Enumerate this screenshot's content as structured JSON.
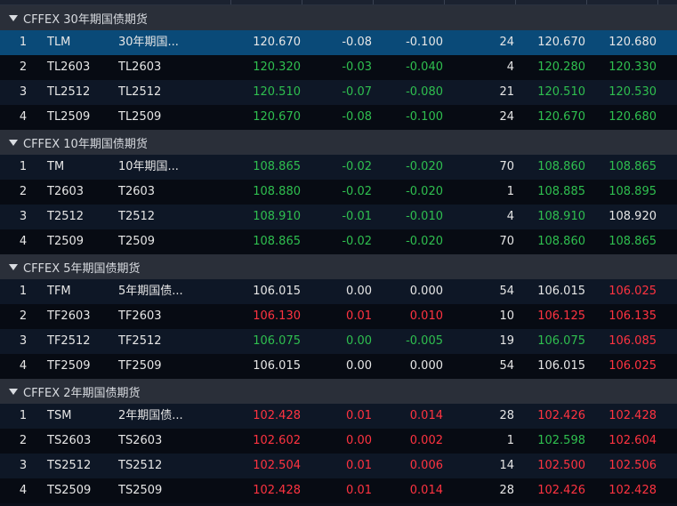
{
  "colors": {
    "up": "#ff3340",
    "down": "#2fbf4f",
    "flat": "#e6e6e6",
    "header_bg": "#2a2f39",
    "selected_bg": "#0a4a78",
    "row_odd": "#0e1726",
    "row_even": "#070b13"
  },
  "icons": {
    "group_toggle": "triangle-down-icon"
  },
  "groups": [
    {
      "title": "CFFEX 30年期国债期货",
      "rows": [
        {
          "idx": "1",
          "code": "TLM",
          "name": "30年期国...",
          "last": "120.670",
          "chg": "-0.08",
          "pct": "-0.100",
          "vol": "24",
          "bid": "120.670",
          "ask": "120.680",
          "c_last": "flat",
          "c_chg": "flat",
          "c_pct": "flat",
          "c_bid": "flat",
          "c_ask": "flat",
          "selected": true
        },
        {
          "idx": "2",
          "code": "TL2603",
          "name": "TL2603",
          "last": "120.320",
          "chg": "-0.03",
          "pct": "-0.040",
          "vol": "4",
          "bid": "120.280",
          "ask": "120.330",
          "c_last": "down",
          "c_chg": "down",
          "c_pct": "down",
          "c_bid": "down",
          "c_ask": "down"
        },
        {
          "idx": "3",
          "code": "TL2512",
          "name": "TL2512",
          "last": "120.510",
          "chg": "-0.07",
          "pct": "-0.080",
          "vol": "21",
          "bid": "120.510",
          "ask": "120.530",
          "c_last": "down",
          "c_chg": "down",
          "c_pct": "down",
          "c_bid": "down",
          "c_ask": "down"
        },
        {
          "idx": "4",
          "code": "TL2509",
          "name": "TL2509",
          "last": "120.670",
          "chg": "-0.08",
          "pct": "-0.100",
          "vol": "24",
          "bid": "120.670",
          "ask": "120.680",
          "c_last": "down",
          "c_chg": "down",
          "c_pct": "down",
          "c_bid": "down",
          "c_ask": "down"
        }
      ]
    },
    {
      "title": "CFFEX 10年期国债期货",
      "rows": [
        {
          "idx": "1",
          "code": "TM",
          "name": "10年期国...",
          "last": "108.865",
          "chg": "-0.02",
          "pct": "-0.020",
          "vol": "70",
          "bid": "108.860",
          "ask": "108.865",
          "c_last": "down",
          "c_chg": "down",
          "c_pct": "down",
          "c_bid": "down",
          "c_ask": "down"
        },
        {
          "idx": "2",
          "code": "T2603",
          "name": "T2603",
          "last": "108.880",
          "chg": "-0.02",
          "pct": "-0.020",
          "vol": "1",
          "bid": "108.885",
          "ask": "108.895",
          "c_last": "down",
          "c_chg": "down",
          "c_pct": "down",
          "c_bid": "down",
          "c_ask": "down"
        },
        {
          "idx": "3",
          "code": "T2512",
          "name": "T2512",
          "last": "108.910",
          "chg": "-0.01",
          "pct": "-0.010",
          "vol": "4",
          "bid": "108.910",
          "ask": "108.920",
          "c_last": "down",
          "c_chg": "down",
          "c_pct": "down",
          "c_bid": "down",
          "c_ask": "flat"
        },
        {
          "idx": "4",
          "code": "T2509",
          "name": "T2509",
          "last": "108.865",
          "chg": "-0.02",
          "pct": "-0.020",
          "vol": "70",
          "bid": "108.860",
          "ask": "108.865",
          "c_last": "down",
          "c_chg": "down",
          "c_pct": "down",
          "c_bid": "down",
          "c_ask": "down"
        }
      ]
    },
    {
      "title": "CFFEX 5年期国债期货",
      "rows": [
        {
          "idx": "1",
          "code": "TFM",
          "name": "5年期国债...",
          "last": "106.015",
          "chg": "0.00",
          "pct": "0.000",
          "vol": "54",
          "bid": "106.015",
          "ask": "106.025",
          "c_last": "flat",
          "c_chg": "flat",
          "c_pct": "flat",
          "c_bid": "flat",
          "c_ask": "up"
        },
        {
          "idx": "2",
          "code": "TF2603",
          "name": "TF2603",
          "last": "106.130",
          "chg": "0.01",
          "pct": "0.010",
          "vol": "10",
          "bid": "106.125",
          "ask": "106.135",
          "c_last": "up",
          "c_chg": "up",
          "c_pct": "up",
          "c_bid": "up",
          "c_ask": "up"
        },
        {
          "idx": "3",
          "code": "TF2512",
          "name": "TF2512",
          "last": "106.075",
          "chg": "0.00",
          "pct": "-0.005",
          "vol": "19",
          "bid": "106.075",
          "ask": "106.085",
          "c_last": "down",
          "c_chg": "down",
          "c_pct": "down",
          "c_bid": "down",
          "c_ask": "up"
        },
        {
          "idx": "4",
          "code": "TF2509",
          "name": "TF2509",
          "last": "106.015",
          "chg": "0.00",
          "pct": "0.000",
          "vol": "54",
          "bid": "106.015",
          "ask": "106.025",
          "c_last": "flat",
          "c_chg": "flat",
          "c_pct": "flat",
          "c_bid": "flat",
          "c_ask": "up"
        }
      ]
    },
    {
      "title": "CFFEX 2年期国债期货",
      "rows": [
        {
          "idx": "1",
          "code": "TSM",
          "name": "2年期国债...",
          "last": "102.428",
          "chg": "0.01",
          "pct": "0.014",
          "vol": "28",
          "bid": "102.426",
          "ask": "102.428",
          "c_last": "up",
          "c_chg": "up",
          "c_pct": "up",
          "c_bid": "up",
          "c_ask": "up"
        },
        {
          "idx": "2",
          "code": "TS2603",
          "name": "TS2603",
          "last": "102.602",
          "chg": "0.00",
          "pct": "0.002",
          "vol": "1",
          "bid": "102.598",
          "ask": "102.604",
          "c_last": "up",
          "c_chg": "up",
          "c_pct": "up",
          "c_bid": "down",
          "c_ask": "up"
        },
        {
          "idx": "3",
          "code": "TS2512",
          "name": "TS2512",
          "last": "102.504",
          "chg": "0.01",
          "pct": "0.006",
          "vol": "14",
          "bid": "102.500",
          "ask": "102.506",
          "c_last": "up",
          "c_chg": "up",
          "c_pct": "up",
          "c_bid": "up",
          "c_ask": "up"
        },
        {
          "idx": "4",
          "code": "TS2509",
          "name": "TS2509",
          "last": "102.428",
          "chg": "0.01",
          "pct": "0.014",
          "vol": "28",
          "bid": "102.426",
          "ask": "102.428",
          "c_last": "up",
          "c_chg": "up",
          "c_pct": "up",
          "c_bid": "up",
          "c_ask": "up"
        }
      ]
    }
  ]
}
